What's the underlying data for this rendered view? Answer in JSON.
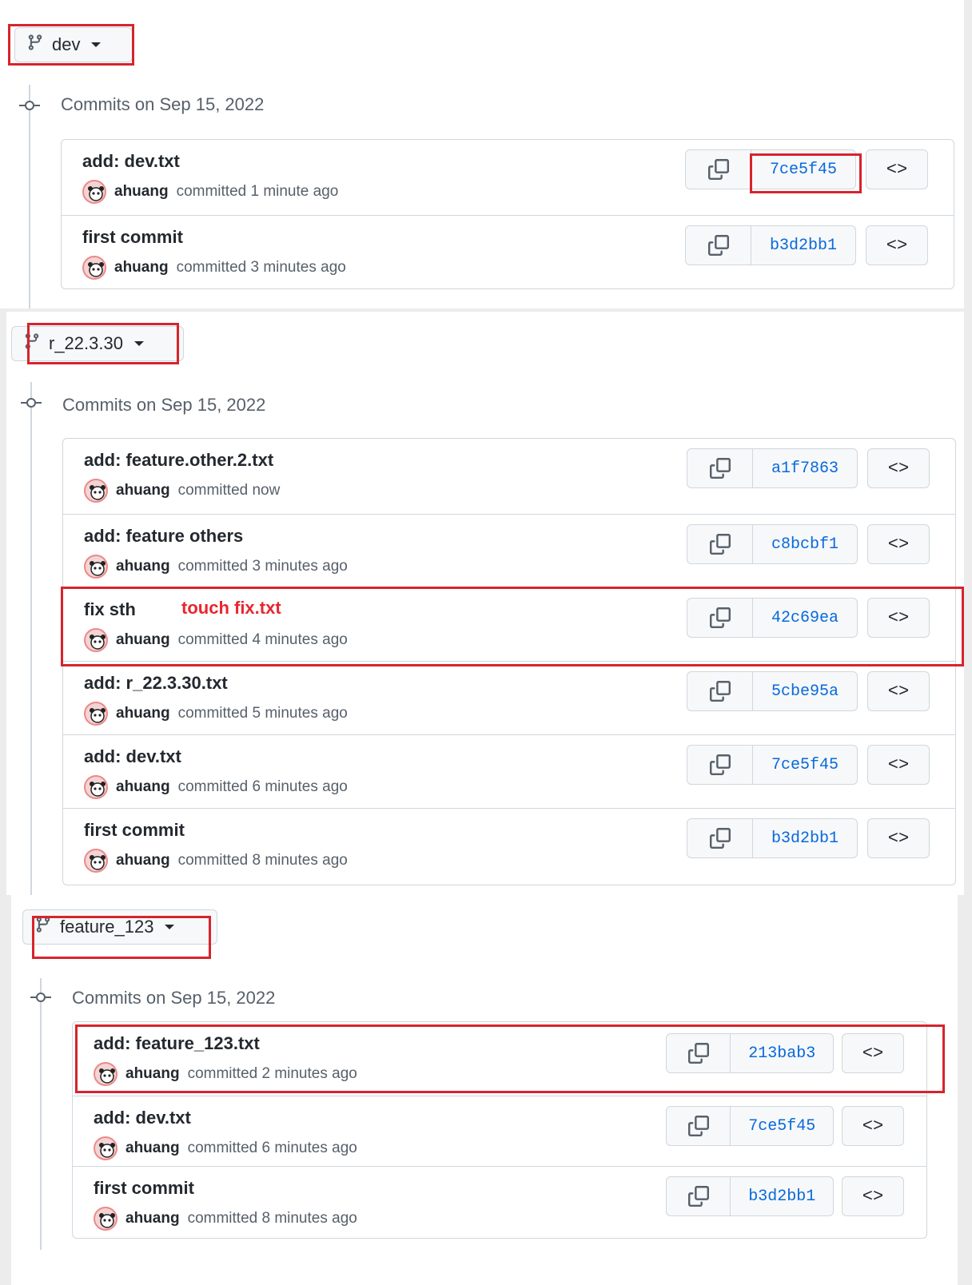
{
  "panels": [
    {
      "branch": "dev",
      "date_header": "Commits on Sep 15, 2022",
      "commits": [
        {
          "message": "add: dev.txt",
          "author": "ahuang",
          "time": "committed 1 minute ago",
          "sha": "7ce5f45"
        },
        {
          "message": "first commit",
          "author": "ahuang",
          "time": "committed 3 minutes ago",
          "sha": "b3d2bb1"
        }
      ]
    },
    {
      "branch": "r_22.3.30",
      "date_header": "Commits on Sep 15, 2022",
      "commits": [
        {
          "message": "add: feature.other.2.txt",
          "author": "ahuang",
          "time": "committed now",
          "sha": "a1f7863"
        },
        {
          "message": "add: feature others",
          "author": "ahuang",
          "time": "committed 3 minutes ago",
          "sha": "c8bcbf1"
        },
        {
          "message": "fix sth",
          "author": "ahuang",
          "time": "committed 4 minutes ago",
          "sha": "42c69ea"
        },
        {
          "message": "add: r_22.3.30.txt",
          "author": "ahuang",
          "time": "committed 5 minutes ago",
          "sha": "5cbe95a"
        },
        {
          "message": "add: dev.txt",
          "author": "ahuang",
          "time": "committed 6 minutes ago",
          "sha": "7ce5f45"
        },
        {
          "message": "first commit",
          "author": "ahuang",
          "time": "committed 8 minutes ago",
          "sha": "b3d2bb1"
        }
      ],
      "annotation": "touch fix.txt"
    },
    {
      "branch": "feature_123",
      "date_header": "Commits on Sep 15, 2022",
      "commits": [
        {
          "message": "add: feature_123.txt",
          "author": "ahuang",
          "time": "committed 2 minutes ago",
          "sha": "213bab3"
        },
        {
          "message": "add: dev.txt",
          "author": "ahuang",
          "time": "committed 6 minutes ago",
          "sha": "7ce5f45"
        },
        {
          "message": "first commit",
          "author": "ahuang",
          "time": "committed 8 minutes ago",
          "sha": "b3d2bb1"
        }
      ]
    }
  ],
  "browse_label": "<>",
  "colors": {
    "highlight": "#d6242c",
    "sha": "#0969da",
    "annotation": "#e8262f"
  },
  "icons": [
    "branch-icon",
    "commit-node-icon",
    "copy-icon",
    "avatar-icon"
  ]
}
